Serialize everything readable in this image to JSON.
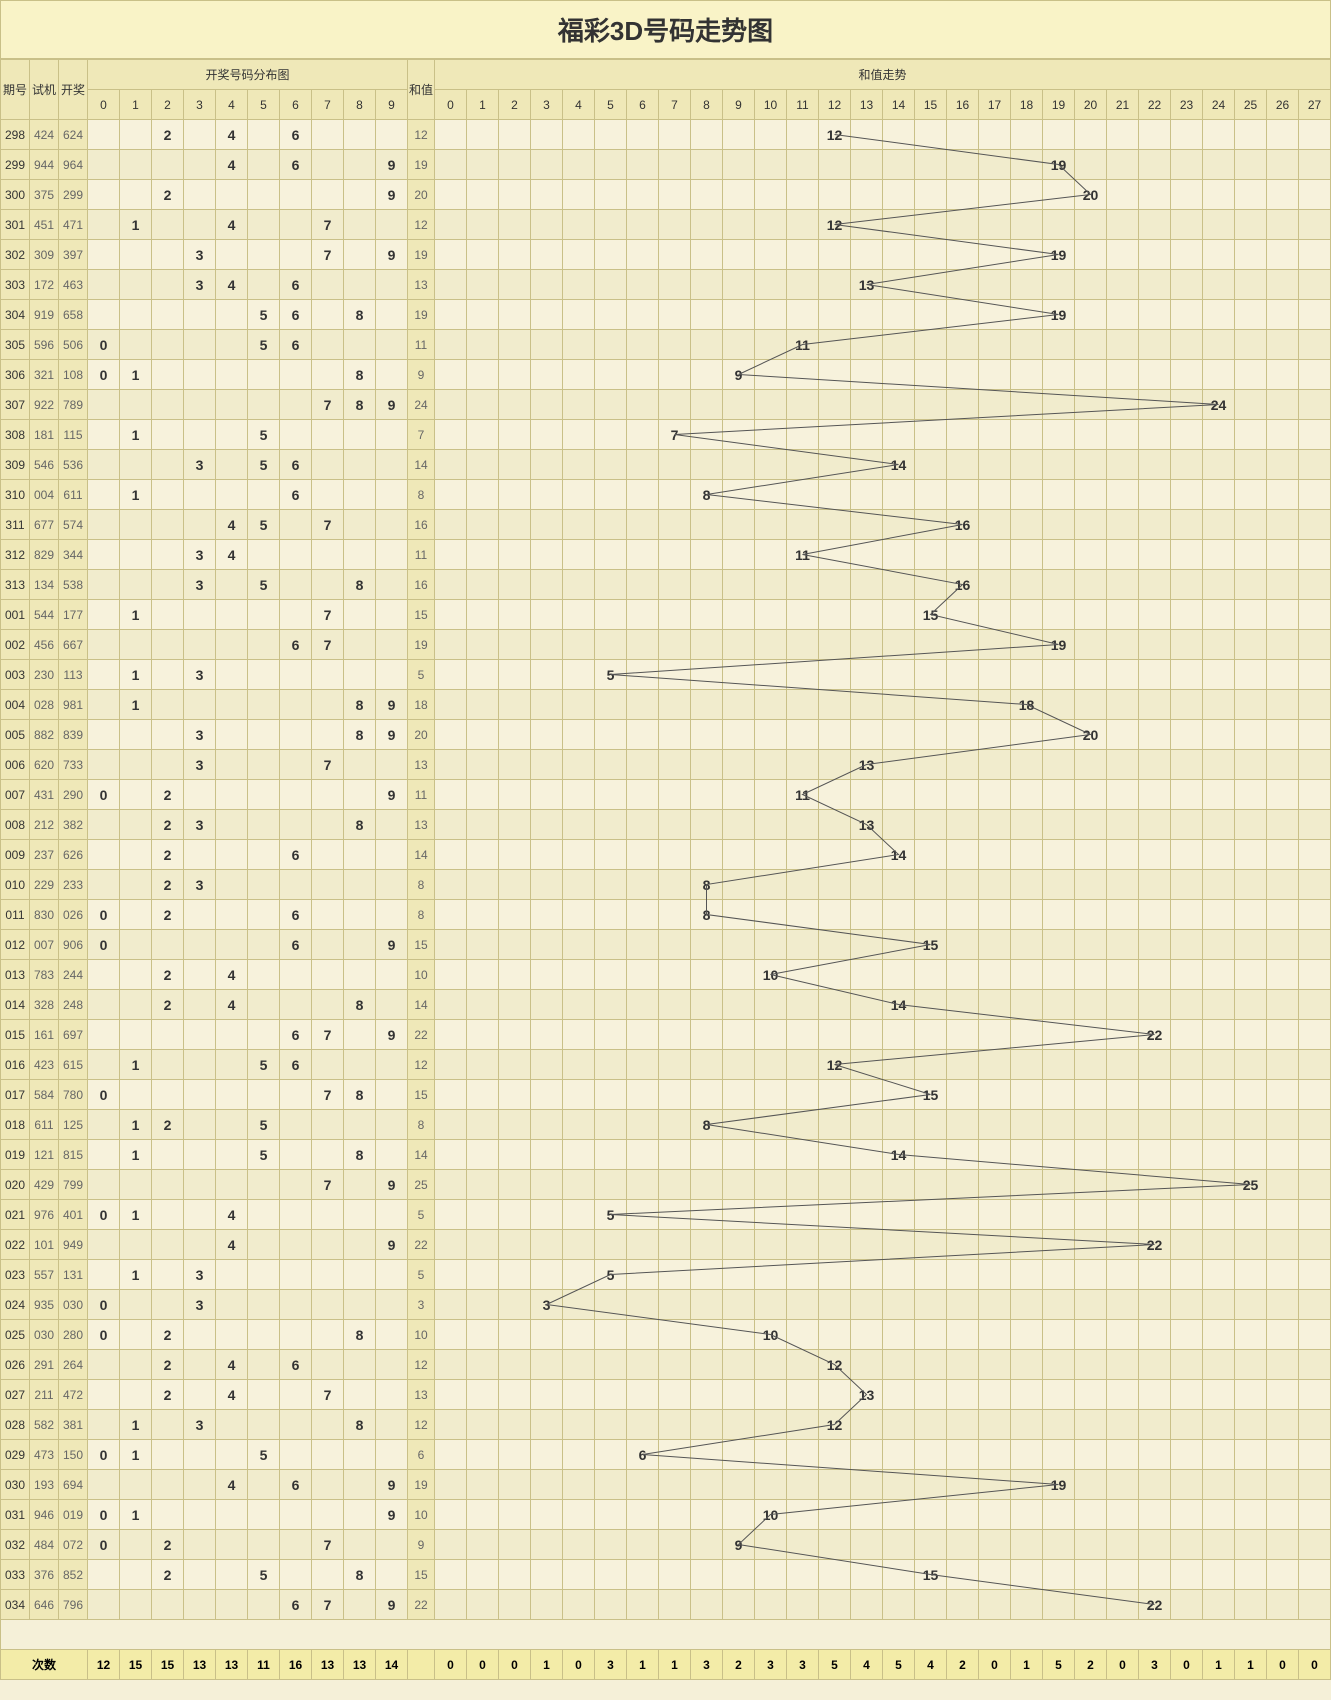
{
  "title": "福彩3D号码走势图",
  "headers": {
    "qi": "期号",
    "sj": "试机",
    "kj": "开奖",
    "dist": "开奖号码分布图",
    "hz": "和值",
    "sumTrend": "和值走势",
    "foot": "次数"
  },
  "digitCols": [
    0,
    1,
    2,
    3,
    4,
    5,
    6,
    7,
    8,
    9
  ],
  "sumCols": [
    0,
    1,
    2,
    3,
    4,
    5,
    6,
    7,
    8,
    9,
    10,
    11,
    12,
    13,
    14,
    15,
    16,
    17,
    18,
    19,
    20,
    21,
    22,
    23,
    24,
    25,
    26,
    27
  ],
  "rows": [
    {
      "qi": "298",
      "sj": "424",
      "kj": "624",
      "d": [
        2,
        4,
        6
      ],
      "hz": 12
    },
    {
      "qi": "299",
      "sj": "944",
      "kj": "964",
      "d": [
        4,
        6,
        9
      ],
      "hz": 19
    },
    {
      "qi": "300",
      "sj": "375",
      "kj": "299",
      "d": [
        2,
        9
      ],
      "hz": 20
    },
    {
      "qi": "301",
      "sj": "451",
      "kj": "471",
      "d": [
        1,
        4,
        7
      ],
      "hz": 12
    },
    {
      "qi": "302",
      "sj": "309",
      "kj": "397",
      "d": [
        3,
        7,
        9
      ],
      "hz": 19
    },
    {
      "qi": "303",
      "sj": "172",
      "kj": "463",
      "d": [
        3,
        4,
        6
      ],
      "hz": 13
    },
    {
      "qi": "304",
      "sj": "919",
      "kj": "658",
      "d": [
        5,
        6,
        8
      ],
      "hz": 19
    },
    {
      "qi": "305",
      "sj": "596",
      "kj": "506",
      "d": [
        0,
        5,
        6
      ],
      "hz": 11
    },
    {
      "qi": "306",
      "sj": "321",
      "kj": "108",
      "d": [
        0,
        1,
        8
      ],
      "hz": 9
    },
    {
      "qi": "307",
      "sj": "922",
      "kj": "789",
      "d": [
        7,
        8,
        9
      ],
      "hz": 24
    },
    {
      "qi": "308",
      "sj": "181",
      "kj": "115",
      "d": [
        1,
        5
      ],
      "hz": 7
    },
    {
      "qi": "309",
      "sj": "546",
      "kj": "536",
      "d": [
        3,
        5,
        6
      ],
      "hz": 14
    },
    {
      "qi": "310",
      "sj": "004",
      "kj": "611",
      "d": [
        1,
        6
      ],
      "hz": 8
    },
    {
      "qi": "311",
      "sj": "677",
      "kj": "574",
      "d": [
        4,
        5,
        7
      ],
      "hz": 16
    },
    {
      "qi": "312",
      "sj": "829",
      "kj": "344",
      "d": [
        3,
        4
      ],
      "hz": 11
    },
    {
      "qi": "313",
      "sj": "134",
      "kj": "538",
      "d": [
        3,
        5,
        8
      ],
      "hz": 16
    },
    {
      "qi": "001",
      "sj": "544",
      "kj": "177",
      "d": [
        1,
        7
      ],
      "hz": 15
    },
    {
      "qi": "002",
      "sj": "456",
      "kj": "667",
      "d": [
        6,
        7
      ],
      "hz": 19
    },
    {
      "qi": "003",
      "sj": "230",
      "kj": "113",
      "d": [
        1,
        3
      ],
      "hz": 5
    },
    {
      "qi": "004",
      "sj": "028",
      "kj": "981",
      "d": [
        1,
        8,
        9
      ],
      "hz": 18
    },
    {
      "qi": "005",
      "sj": "882",
      "kj": "839",
      "d": [
        3,
        8,
        9
      ],
      "hz": 20
    },
    {
      "qi": "006",
      "sj": "620",
      "kj": "733",
      "d": [
        3,
        7
      ],
      "hz": 13
    },
    {
      "qi": "007",
      "sj": "431",
      "kj": "290",
      "d": [
        0,
        2,
        9
      ],
      "hz": 11
    },
    {
      "qi": "008",
      "sj": "212",
      "kj": "382",
      "d": [
        2,
        3,
        8
      ],
      "hz": 13
    },
    {
      "qi": "009",
      "sj": "237",
      "kj": "626",
      "d": [
        2,
        6
      ],
      "hz": 14
    },
    {
      "qi": "010",
      "sj": "229",
      "kj": "233",
      "d": [
        2,
        3
      ],
      "hz": 8
    },
    {
      "qi": "011",
      "sj": "830",
      "kj": "026",
      "d": [
        0,
        2,
        6
      ],
      "hz": 8
    },
    {
      "qi": "012",
      "sj": "007",
      "kj": "906",
      "d": [
        0,
        6,
        9
      ],
      "hz": 15
    },
    {
      "qi": "013",
      "sj": "783",
      "kj": "244",
      "d": [
        2,
        4
      ],
      "hz": 10
    },
    {
      "qi": "014",
      "sj": "328",
      "kj": "248",
      "d": [
        2,
        4,
        8
      ],
      "hz": 14
    },
    {
      "qi": "015",
      "sj": "161",
      "kj": "697",
      "d": [
        6,
        7,
        9
      ],
      "hz": 22
    },
    {
      "qi": "016",
      "sj": "423",
      "kj": "615",
      "d": [
        1,
        5,
        6
      ],
      "hz": 12
    },
    {
      "qi": "017",
      "sj": "584",
      "kj": "780",
      "d": [
        0,
        7,
        8
      ],
      "hz": 15
    },
    {
      "qi": "018",
      "sj": "611",
      "kj": "125",
      "d": [
        1,
        2,
        5
      ],
      "hz": 8
    },
    {
      "qi": "019",
      "sj": "121",
      "kj": "815",
      "d": [
        1,
        5,
        8
      ],
      "hz": 14
    },
    {
      "qi": "020",
      "sj": "429",
      "kj": "799",
      "d": [
        7,
        9
      ],
      "hz": 25
    },
    {
      "qi": "021",
      "sj": "976",
      "kj": "401",
      "d": [
        0,
        1,
        4
      ],
      "hz": 5
    },
    {
      "qi": "022",
      "sj": "101",
      "kj": "949",
      "d": [
        4,
        9
      ],
      "hz": 22
    },
    {
      "qi": "023",
      "sj": "557",
      "kj": "131",
      "d": [
        1,
        3
      ],
      "hz": 5
    },
    {
      "qi": "024",
      "sj": "935",
      "kj": "030",
      "d": [
        0,
        3
      ],
      "hz": 3
    },
    {
      "qi": "025",
      "sj": "030",
      "kj": "280",
      "d": [
        0,
        2,
        8
      ],
      "hz": 10
    },
    {
      "qi": "026",
      "sj": "291",
      "kj": "264",
      "d": [
        2,
        4,
        6
      ],
      "hz": 12
    },
    {
      "qi": "027",
      "sj": "211",
      "kj": "472",
      "d": [
        2,
        4,
        7
      ],
      "hz": 13
    },
    {
      "qi": "028",
      "sj": "582",
      "kj": "381",
      "d": [
        1,
        3,
        8
      ],
      "hz": 12
    },
    {
      "qi": "029",
      "sj": "473",
      "kj": "150",
      "d": [
        0,
        1,
        5
      ],
      "hz": 6
    },
    {
      "qi": "030",
      "sj": "193",
      "kj": "694",
      "d": [
        4,
        6,
        9
      ],
      "hz": 19
    },
    {
      "qi": "031",
      "sj": "946",
      "kj": "019",
      "d": [
        0,
        1,
        9
      ],
      "hz": 10
    },
    {
      "qi": "032",
      "sj": "484",
      "kj": "072",
      "d": [
        0,
        2,
        7
      ],
      "hz": 9
    },
    {
      "qi": "033",
      "sj": "376",
      "kj": "852",
      "d": [
        2,
        5,
        8
      ],
      "hz": 15
    },
    {
      "qi": "034",
      "sj": "646",
      "kj": "796",
      "d": [
        6,
        7,
        9
      ],
      "hz": 22
    }
  ],
  "footDigits": [
    12,
    15,
    15,
    13,
    13,
    11,
    16,
    13,
    13,
    14
  ],
  "footSums": [
    0,
    0,
    0,
    1,
    0,
    3,
    1,
    1,
    3,
    2,
    3,
    3,
    5,
    4,
    5,
    4,
    2,
    0,
    1,
    5,
    2,
    0,
    3,
    0,
    1,
    1,
    0,
    0
  ],
  "chart_data": {
    "type": "line",
    "title": "和值走势",
    "xlabel": "期号",
    "ylabel": "和值",
    "ylim": [
      0,
      27
    ],
    "x": [
      "298",
      "299",
      "300",
      "301",
      "302",
      "303",
      "304",
      "305",
      "306",
      "307",
      "308",
      "309",
      "310",
      "311",
      "312",
      "313",
      "001",
      "002",
      "003",
      "004",
      "005",
      "006",
      "007",
      "008",
      "009",
      "010",
      "011",
      "012",
      "013",
      "014",
      "015",
      "016",
      "017",
      "018",
      "019",
      "020",
      "021",
      "022",
      "023",
      "024",
      "025",
      "026",
      "027",
      "028",
      "029",
      "030",
      "031",
      "032",
      "033",
      "034"
    ],
    "values": [
      12,
      19,
      20,
      12,
      19,
      13,
      19,
      11,
      9,
      24,
      7,
      14,
      8,
      16,
      11,
      16,
      15,
      19,
      5,
      18,
      20,
      13,
      11,
      13,
      14,
      8,
      8,
      15,
      10,
      14,
      22,
      12,
      15,
      8,
      14,
      25,
      5,
      22,
      5,
      3,
      10,
      12,
      13,
      12,
      6,
      19,
      10,
      9,
      15,
      22
    ]
  }
}
